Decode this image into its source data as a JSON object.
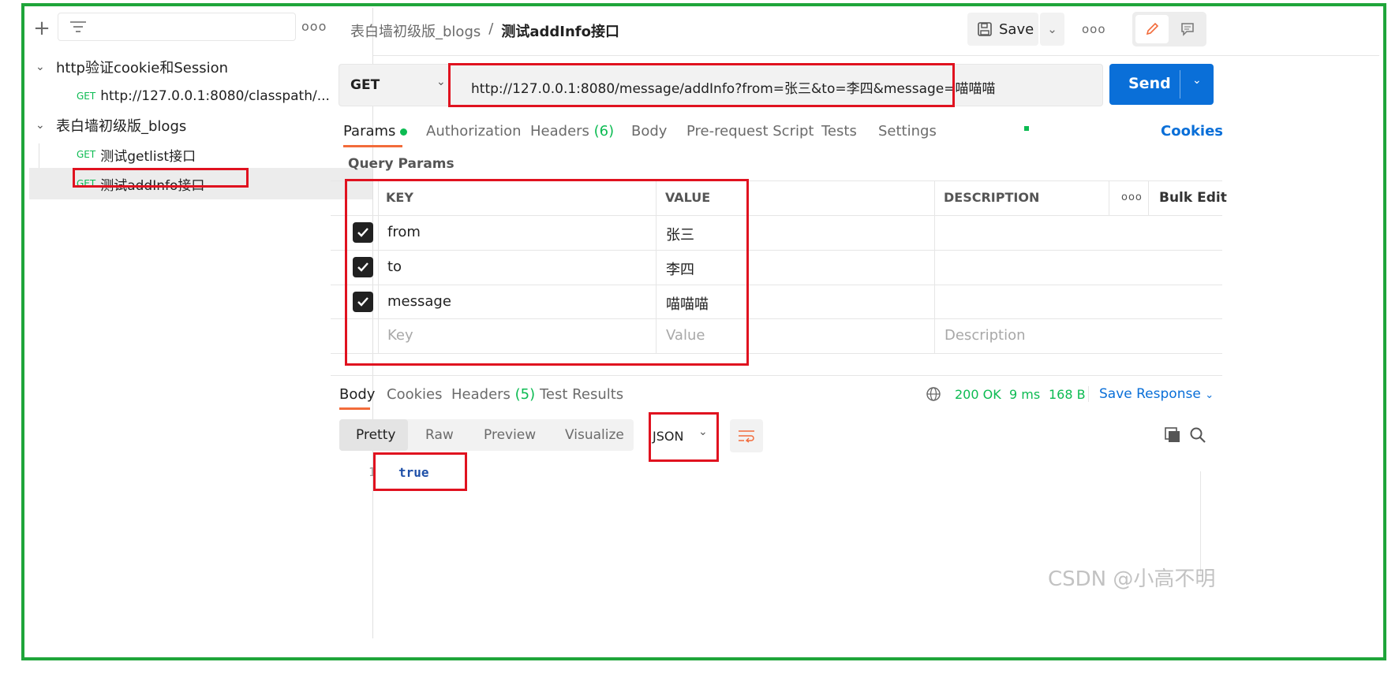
{
  "sidebar": {
    "filter_placeholder": "",
    "collections": [
      {
        "name": "http验证cookie和Session",
        "requests": [
          {
            "method": "GET",
            "name": "http://127.0.0.1:8080/classpath/..."
          }
        ]
      },
      {
        "name": "表白墙初级版_blogs",
        "requests": [
          {
            "method": "GET",
            "name": "测试getlist接口"
          },
          {
            "method": "GET",
            "name": "测试addInfo接口"
          }
        ]
      }
    ]
  },
  "header": {
    "breadcrumb_collection": "表白墙初级版_blogs",
    "breadcrumb_sep": "/",
    "request_name": "测试addInfo接口",
    "save_label": "Save"
  },
  "request": {
    "method": "GET",
    "url": "http://127.0.0.1:8080/message/addInfo?from=张三&to=李四&message=喵喵喵",
    "send_label": "Send"
  },
  "request_tabs": {
    "params": "Params",
    "authorization": "Authorization",
    "headers": "Headers",
    "headers_count": "(6)",
    "body": "Body",
    "prerequest": "Pre-request Script",
    "tests": "Tests",
    "settings": "Settings",
    "cookies": "Cookies"
  },
  "query_params": {
    "title": "Query Params",
    "columns": {
      "key": "KEY",
      "value": "VALUE",
      "description": "DESCRIPTION",
      "bulk_edit": "Bulk Edit"
    },
    "rows": [
      {
        "key": "from",
        "value": "张三"
      },
      {
        "key": "to",
        "value": "李四"
      },
      {
        "key": "message",
        "value": "喵喵喵"
      }
    ],
    "placeholders": {
      "key": "Key",
      "value": "Value",
      "description": "Description"
    }
  },
  "response": {
    "tabs": {
      "body": "Body",
      "cookies": "Cookies",
      "headers": "Headers",
      "headers_count": "(5)",
      "test_results": "Test Results"
    },
    "status": "200 OK",
    "time": "9 ms",
    "size": "168 B",
    "save_response": "Save Response",
    "view_modes": {
      "pretty": "Pretty",
      "raw": "Raw",
      "preview": "Preview",
      "visualize": "Visualize"
    },
    "format": "JSON",
    "line_number": "1",
    "body_text": "true"
  },
  "watermark": "CSDN @小高不明",
  "colors": {
    "accent_blue": "#0a6fd8",
    "status_green": "#0cbb52",
    "highlight_red": "#e0121f",
    "frame_green": "#1fa53a",
    "active_tab": "#f26b3a"
  }
}
